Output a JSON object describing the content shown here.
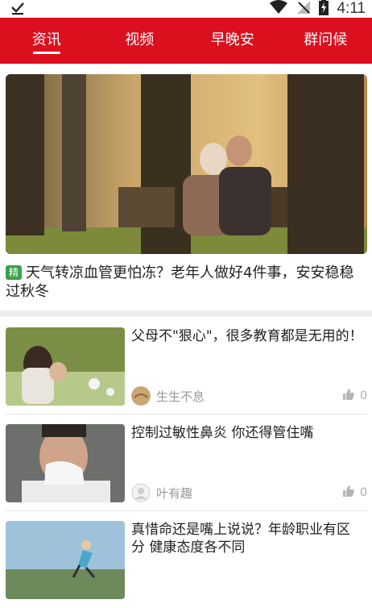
{
  "status_bar": {
    "time": "4:11"
  },
  "tabs": [
    "资讯",
    "视频",
    "早晚安",
    "群问候"
  ],
  "feature": {
    "badge": "精",
    "title": "天气转凉血管更怕冻？老年人做好4件事，安安稳稳过秋冬"
  },
  "articles": [
    {
      "title": "父母不\"狠心\"，很多教育都是无用的！",
      "author": "生生不息",
      "likes": "0"
    },
    {
      "title": "控制过敏性鼻炎 你还得管住嘴",
      "author": "叶有趣",
      "likes": "0"
    },
    {
      "title": "真惜命还是嘴上说说？年龄职业有区分 健康态度各不同",
      "author": "",
      "likes": ""
    }
  ],
  "colors": {
    "header": "#dc0f1e",
    "badge": "#3aa14a"
  }
}
